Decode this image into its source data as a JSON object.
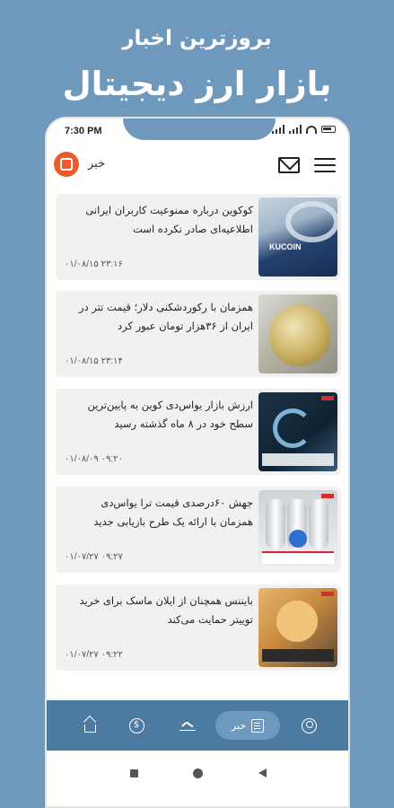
{
  "promo": {
    "line1": "بروزترین اخبار",
    "line2": "بازار ارز دیجیتال"
  },
  "status_bar": {
    "time": "7:30 PM"
  },
  "app_bar": {
    "title": "خبر"
  },
  "news": [
    {
      "headline": "کوکوین درباره ممنوعیت کاربران ایرانی اطلاعیه‌ای صادر نکرده است",
      "date": "۲۳:۱۶ ۰۱/۰۸/۱۵",
      "thumb_label": "KUCOIN"
    },
    {
      "headline": "همزمان با رکوردشکنی دلار؛ قیمت تتر در ایران از ۳۶هزار تومان عبور کرد",
      "date": "۲۳:۱۴ ۰۱/۰۸/۱۵"
    },
    {
      "headline": "ارزش بازار یواس‌دی کوین به پایین‌ترین سطح خود در ۸ ماه گذشته رسید",
      "date": "۰۹:۲۰ ۰۱/۰۸/۰۹"
    },
    {
      "headline": "جهش ۶۰درصدی قیمت ترا یواس‌دی همزمان با ارائه یک طرح بازیابی جدید",
      "date": "۰۹:۲۷ ۰۱/۰۷/۲۷"
    },
    {
      "headline": "بایننس همچنان از ایلان ماسک برای خرید توییتر حمایت می‌کند",
      "date": "۰۹:۲۲ ۰۱/۰۷/۲۷"
    }
  ],
  "bottom_nav": {
    "items": [
      {
        "icon": "home-icon"
      },
      {
        "icon": "dollar-icon"
      },
      {
        "icon": "chart-icon"
      },
      {
        "icon": "news-icon",
        "label": "خبر",
        "active": true
      },
      {
        "icon": "user-icon"
      }
    ]
  },
  "colors": {
    "background": "#6f98bd",
    "nav_bar": "#4c7aa0",
    "nav_active": "#6e98bc",
    "card": "#f1f1f1",
    "logo": "#ef5a2a"
  }
}
